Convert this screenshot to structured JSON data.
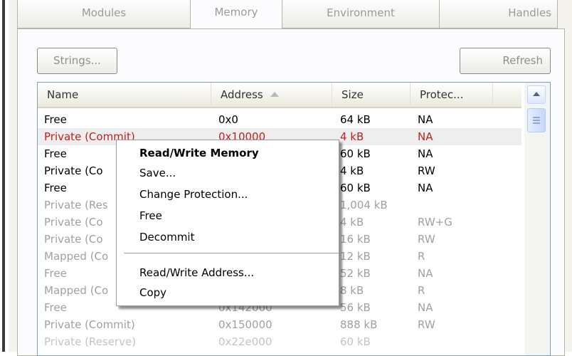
{
  "tabs": [
    {
      "label": "Modules"
    },
    {
      "label": "Memory"
    },
    {
      "label": "Environment"
    },
    {
      "label": "Handles"
    }
  ],
  "toolbar": {
    "strings_label": "Strings...",
    "refresh_label": "Refresh"
  },
  "columns": [
    {
      "label": "Name"
    },
    {
      "label": "Address"
    },
    {
      "label": "Size"
    },
    {
      "label": "Protec..."
    }
  ],
  "rows": [
    {
      "name": "Free",
      "address": "0x0",
      "size": "64 kB",
      "protection": "NA"
    },
    {
      "name": "Private (Commit)",
      "address": "0x10000",
      "size": "4 kB",
      "protection": "NA"
    },
    {
      "name": "Free",
      "address": "",
      "size": "60 kB",
      "protection": "NA"
    },
    {
      "name": "Private (Co",
      "address": "",
      "size": "4 kB",
      "protection": "RW"
    },
    {
      "name": "Free",
      "address": "",
      "size": "60 kB",
      "protection": "NA"
    },
    {
      "name": "Private (Res",
      "address": "",
      "size": "1,004 kB",
      "protection": ""
    },
    {
      "name": "Private (Co",
      "address": "",
      "size": "4 kB",
      "protection": "RW+G"
    },
    {
      "name": "Private (Co",
      "address": "",
      "size": "16 kB",
      "protection": "RW"
    },
    {
      "name": "Mapped (Co",
      "address": "",
      "size": "12 kB",
      "protection": "R"
    },
    {
      "name": "Free",
      "address": "",
      "size": "52 kB",
      "protection": "NA"
    },
    {
      "name": "Mapped (Co",
      "address": "",
      "size": "8 kB",
      "protection": "R"
    },
    {
      "name": "Free",
      "address": "0x142000",
      "size": "56 kB",
      "protection": "NA"
    },
    {
      "name": "Private (Commit)",
      "address": "0x150000",
      "size": "888 kB",
      "protection": "RW"
    },
    {
      "name": "Private (Reserve)",
      "address": "0x22e000",
      "size": "60 kB",
      "protection": ""
    }
  ],
  "context_menu": {
    "items": [
      {
        "label": "Read/Write Memory"
      },
      {
        "label": "Save..."
      },
      {
        "label": "Change Protection..."
      },
      {
        "label": "Free"
      },
      {
        "label": "Decommit"
      },
      {
        "label": "Read/Write Address..."
      },
      {
        "label": "Copy"
      }
    ]
  },
  "colors": {
    "highlight_text": "#c02020",
    "dim_text": "#a0a0a0",
    "tab_text": "#9b9b9b"
  },
  "icons": {
    "sort": "sort-ascending-icon",
    "scroll_up": "scroll-up-arrow-icon",
    "scroll_grip": "scroll-grip-icon"
  }
}
